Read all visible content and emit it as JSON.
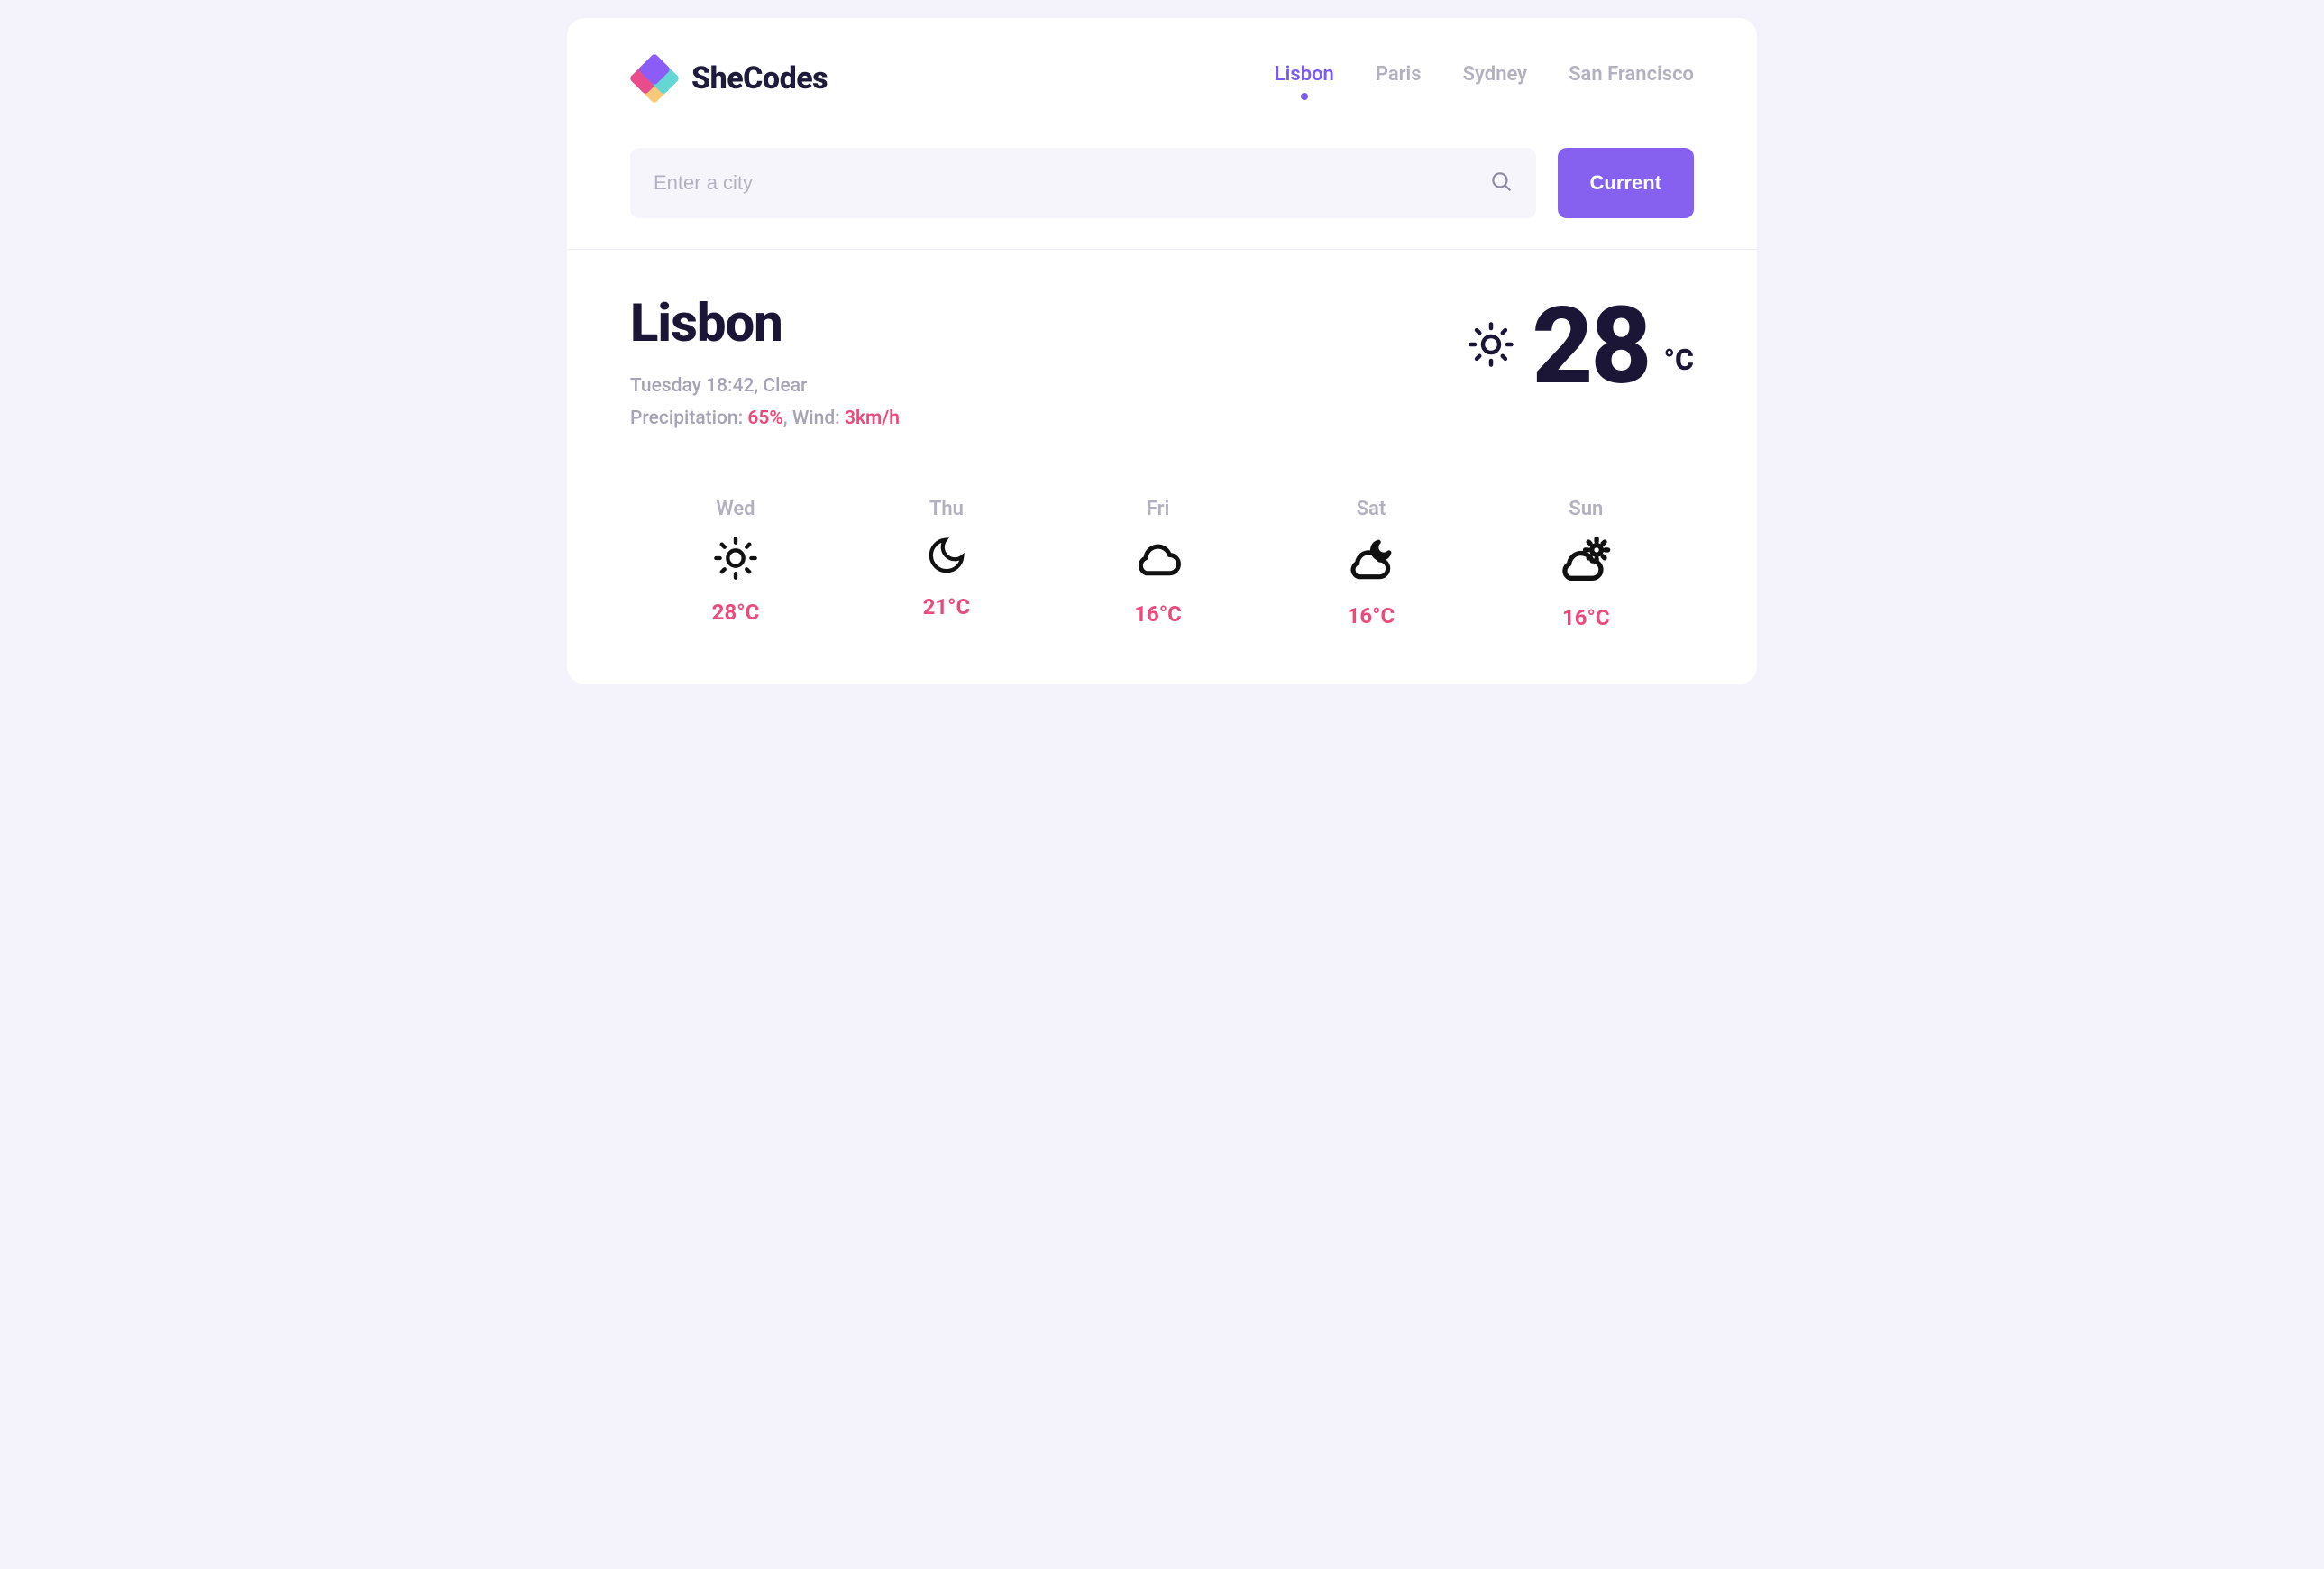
{
  "brand": {
    "name": "SheCodes"
  },
  "nav": {
    "items": [
      {
        "label": "Lisbon",
        "active": true
      },
      {
        "label": "Paris",
        "active": false
      },
      {
        "label": "Sydney",
        "active": false
      },
      {
        "label": "San Francisco",
        "active": false
      }
    ]
  },
  "search": {
    "placeholder": "Enter a city",
    "value": "",
    "button_label": "Current"
  },
  "current": {
    "city": "Lisbon",
    "datetime": "Tuesday 18:42",
    "condition": "Clear",
    "precipitation_label": "Precipitation:",
    "precipitation_value": "65%",
    "wind_label": "Wind:",
    "wind_value": "3km/h",
    "temperature": "28",
    "unit": "°C",
    "icon": "sun"
  },
  "forecast": [
    {
      "day": "Wed",
      "icon": "sun",
      "temp": "28°C"
    },
    {
      "day": "Thu",
      "icon": "moon",
      "temp": "21°C"
    },
    {
      "day": "Fri",
      "icon": "cloud",
      "temp": "16°C"
    },
    {
      "day": "Sat",
      "icon": "cloud-moon",
      "temp": "16°C"
    },
    {
      "day": "Sun",
      "icon": "cloud-sun",
      "temp": "16°C"
    }
  ],
  "colors": {
    "accent": "#8661f0",
    "highlight": "#ec4a7b",
    "text": "#1b1636",
    "muted": "#b3b1bf"
  }
}
